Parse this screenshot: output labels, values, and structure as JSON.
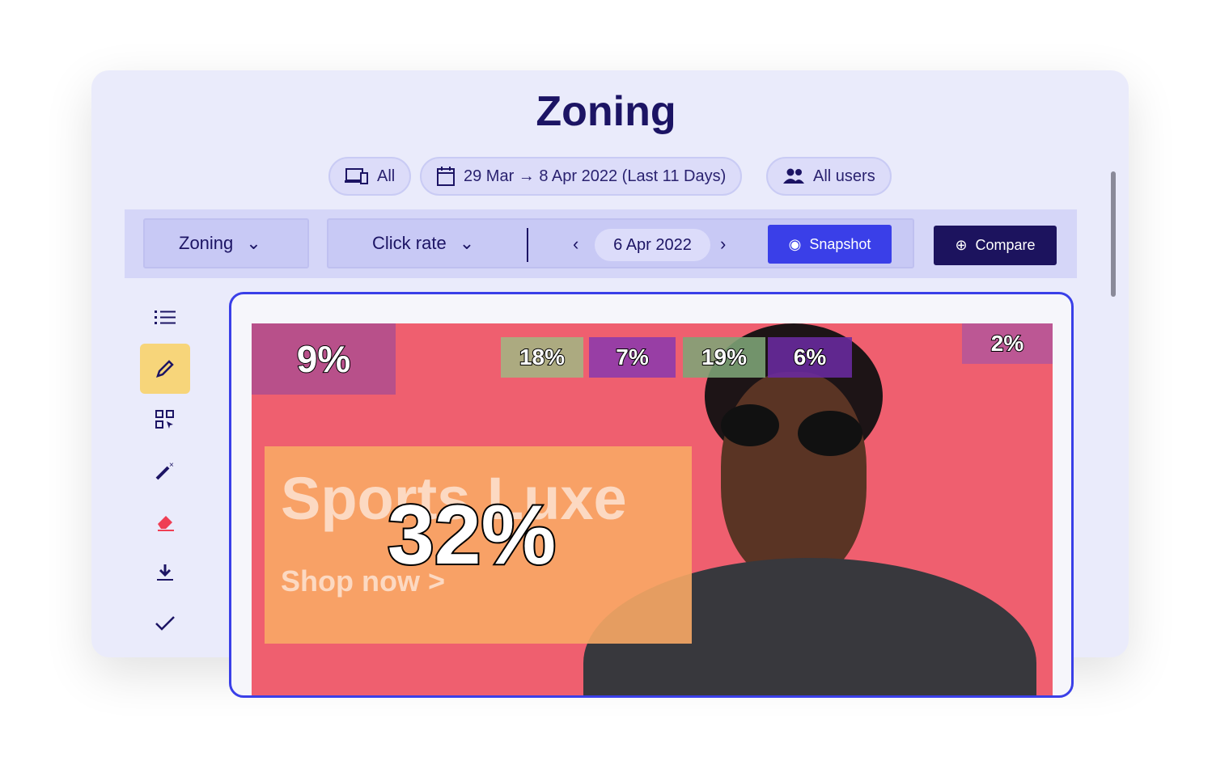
{
  "title": "Zoning",
  "filters": {
    "device": "All",
    "date_range": "29 Mar → 8 Apr 2022 (Last 11 Days)",
    "segment": "All users"
  },
  "toolbar": {
    "view": "Zoning",
    "metric": "Click rate",
    "date": "6 Apr 2022",
    "snapshot": "Snapshot",
    "compare": "Compare"
  },
  "sidebar": [
    "list-icon",
    "edit-icon",
    "zones-icon",
    "magic-wand-icon",
    "eraser-icon",
    "download-icon",
    "check-icon"
  ],
  "banner": {
    "headline": "Sports Luxe",
    "cta": "Shop now >"
  },
  "zones": [
    {
      "value": "9%",
      "color": "#b04f8e"
    },
    {
      "value": "18%",
      "color": "#a3b583"
    },
    {
      "value": "7%",
      "color": "#8c3aad"
    },
    {
      "value": "19%",
      "color": "#7ea577"
    },
    {
      "value": "6%",
      "color": "#6a2aa0"
    },
    {
      "value": "2%",
      "color": "#b5579a"
    },
    {
      "value": "32%",
      "color": "#f8a965"
    }
  ],
  "colors": {
    "accent": "#3a3fe8",
    "dark": "#1c135e"
  }
}
